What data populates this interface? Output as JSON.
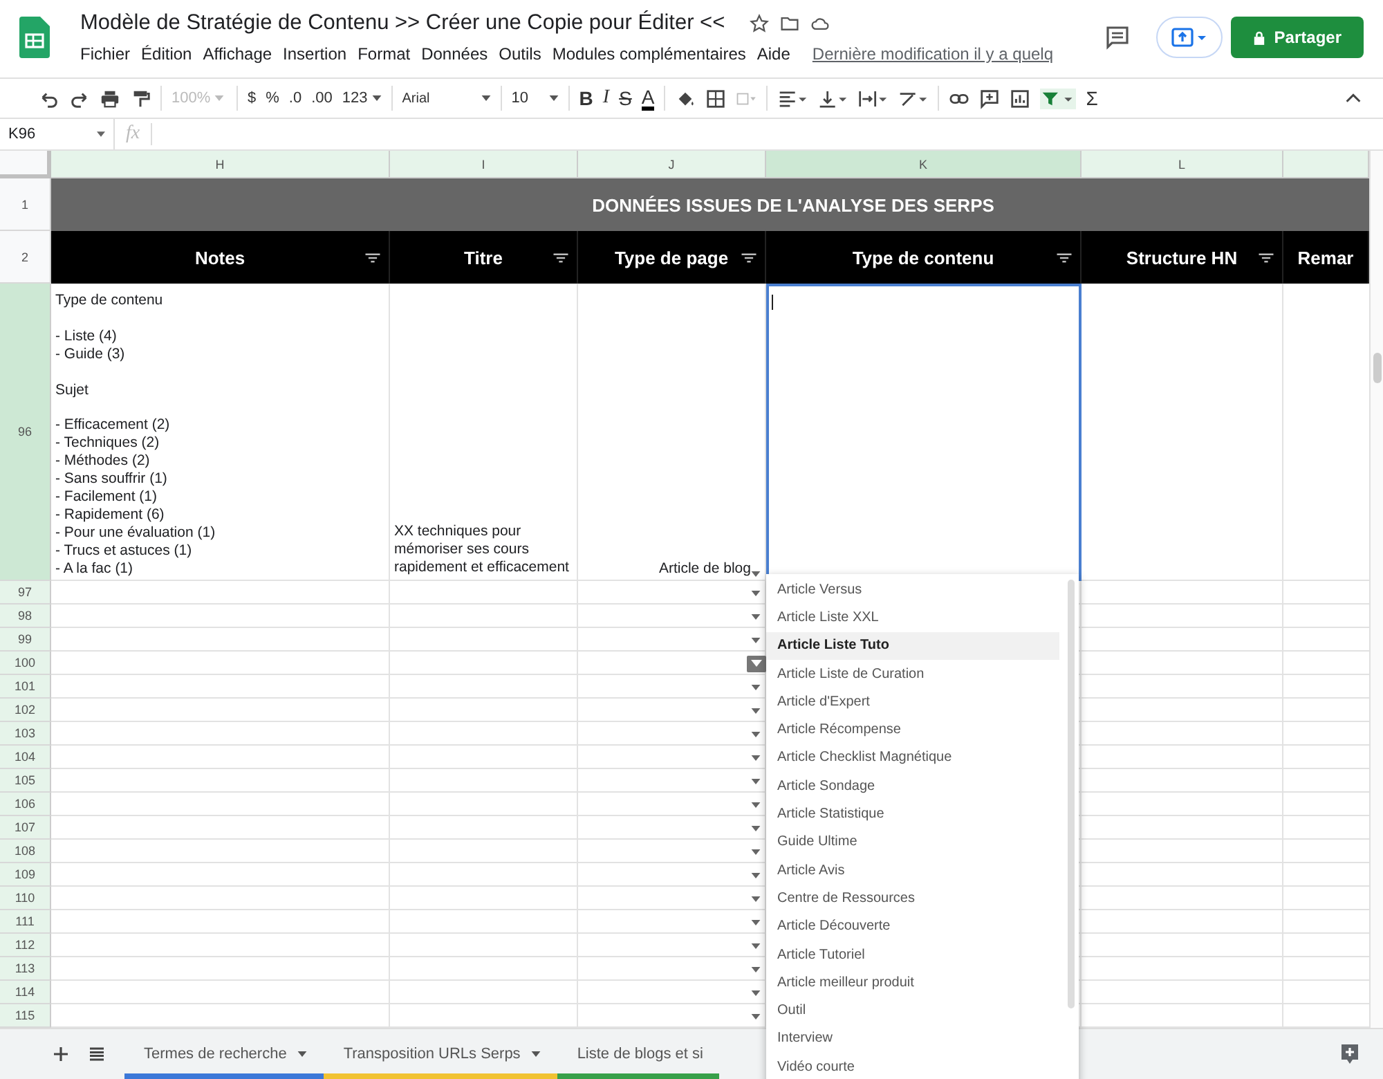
{
  "app": {
    "title": "Modèle de Stratégie de Contenu >> Créer une Copie pour Éditer <<",
    "menu": [
      "Fichier",
      "Édition",
      "Affichage",
      "Insertion",
      "Format",
      "Données",
      "Outils",
      "Modules complémentaires",
      "Aide"
    ],
    "last_edit": "Dernière modification il y a quelq",
    "share_button": "Partager"
  },
  "toolbar": {
    "zoom": {
      "label": "100%",
      "disabled": true
    },
    "currency": "$",
    "percent": "%",
    "decrease_decimals": ".0",
    "increase_decimals": ".00",
    "number_format": "123",
    "font": "Arial",
    "font_size": "10",
    "bold": "B",
    "italic": "I",
    "strikethrough": "S",
    "text_color": "A",
    "functions": "Σ"
  },
  "formula_bar": {
    "cell_ref": "K96",
    "fx": "fx"
  },
  "columns": [
    {
      "letter": "H",
      "selected": false
    },
    {
      "letter": "I",
      "selected": false
    },
    {
      "letter": "J",
      "selected": false
    },
    {
      "letter": "K",
      "selected": true
    },
    {
      "letter": "L",
      "selected": false
    },
    {
      "selected": false
    }
  ],
  "banner_row": {
    "number": "1",
    "text": "DONNÉES ISSUES DE L'ANALYSE DES SERPS"
  },
  "header_row": {
    "number": "2",
    "headers": [
      "Notes",
      "Titre",
      "Type de page",
      "Type de contenu",
      "Structure HN",
      "Remar"
    ]
  },
  "row_96": {
    "number": "96",
    "selected": true,
    "notes": "Type de contenu\n\n- Liste (4)\n- Guide (3)\n\nSujet\n\n- Efficacement (2)\n- Techniques (2)\n- Méthodes (2)\n- Sans souffrir (1)\n- Facilement (1)\n- Rapidement (6)\n- Pour une évaluation (1)\n- Trucs et astuces (1)\n- A la fac (1)",
    "title": "XX techniques pour mémoriser ses cours rapidement et efficacement",
    "page_type": "Article de blog"
  },
  "rows": [
    {
      "number": "97",
      "hovered": false
    },
    {
      "number": "98",
      "hovered": false
    },
    {
      "number": "99",
      "hovered": false
    },
    {
      "number": "100",
      "hovered": true
    },
    {
      "number": "101",
      "hovered": false
    },
    {
      "number": "102",
      "hovered": false
    },
    {
      "number": "103",
      "hovered": false
    },
    {
      "number": "104",
      "hovered": false
    },
    {
      "number": "105",
      "hovered": false
    },
    {
      "number": "106",
      "hovered": false
    },
    {
      "number": "107",
      "hovered": false
    },
    {
      "number": "108",
      "hovered": false
    },
    {
      "number": "109",
      "hovered": false
    },
    {
      "number": "110",
      "hovered": false
    },
    {
      "number": "111",
      "hovered": false
    },
    {
      "number": "112",
      "hovered": false
    },
    {
      "number": "113",
      "hovered": false
    },
    {
      "number": "114",
      "hovered": false
    },
    {
      "number": "115",
      "hovered": false
    }
  ],
  "dropdown": {
    "options": [
      {
        "label": "Article Versus",
        "selected": false
      },
      {
        "label": "Article Liste XXL",
        "selected": false
      },
      {
        "label": "Article Liste Tuto",
        "selected": true
      },
      {
        "label": "Article Liste de Curation",
        "selected": false
      },
      {
        "label": "Article d'Expert",
        "selected": false
      },
      {
        "label": "Article Récompense",
        "selected": false
      },
      {
        "label": "Article Checklist Magnétique",
        "selected": false
      },
      {
        "label": "Article Sondage",
        "selected": false
      },
      {
        "label": "Article Statistique",
        "selected": false
      },
      {
        "label": "Guide Ultime",
        "selected": false
      },
      {
        "label": "Article Avis",
        "selected": false
      },
      {
        "label": "Centre de Ressources",
        "selected": false
      },
      {
        "label": "Article Découverte",
        "selected": false
      },
      {
        "label": "Article Tutoriel",
        "selected": false
      },
      {
        "label": "Article meilleur produit",
        "selected": false
      },
      {
        "label": "Outil",
        "selected": false
      },
      {
        "label": "Interview",
        "selected": false
      },
      {
        "label": "Vidéo courte",
        "selected": false
      }
    ]
  },
  "sheet_tabs": [
    {
      "label": "Termes de recherche",
      "color": "#3c78d8"
    },
    {
      "label": "Transposition URLs Serps",
      "color": "#f1c232"
    },
    {
      "label": "Liste de blogs et si",
      "color": "#38a04a"
    }
  ]
}
